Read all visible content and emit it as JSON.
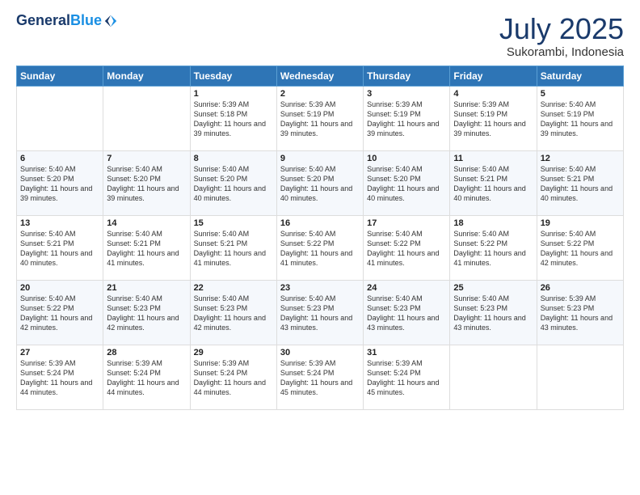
{
  "logo": {
    "line1": "General",
    "line2": "Blue"
  },
  "title": "July 2025",
  "subtitle": "Sukorambi, Indonesia",
  "days_of_week": [
    "Sunday",
    "Monday",
    "Tuesday",
    "Wednesday",
    "Thursday",
    "Friday",
    "Saturday"
  ],
  "weeks": [
    [
      {
        "day": "",
        "info": ""
      },
      {
        "day": "",
        "info": ""
      },
      {
        "day": "1",
        "info": "Sunrise: 5:39 AM\nSunset: 5:18 PM\nDaylight: 11 hours and 39 minutes."
      },
      {
        "day": "2",
        "info": "Sunrise: 5:39 AM\nSunset: 5:19 PM\nDaylight: 11 hours and 39 minutes."
      },
      {
        "day": "3",
        "info": "Sunrise: 5:39 AM\nSunset: 5:19 PM\nDaylight: 11 hours and 39 minutes."
      },
      {
        "day": "4",
        "info": "Sunrise: 5:39 AM\nSunset: 5:19 PM\nDaylight: 11 hours and 39 minutes."
      },
      {
        "day": "5",
        "info": "Sunrise: 5:40 AM\nSunset: 5:19 PM\nDaylight: 11 hours and 39 minutes."
      }
    ],
    [
      {
        "day": "6",
        "info": "Sunrise: 5:40 AM\nSunset: 5:20 PM\nDaylight: 11 hours and 39 minutes."
      },
      {
        "day": "7",
        "info": "Sunrise: 5:40 AM\nSunset: 5:20 PM\nDaylight: 11 hours and 39 minutes."
      },
      {
        "day": "8",
        "info": "Sunrise: 5:40 AM\nSunset: 5:20 PM\nDaylight: 11 hours and 40 minutes."
      },
      {
        "day": "9",
        "info": "Sunrise: 5:40 AM\nSunset: 5:20 PM\nDaylight: 11 hours and 40 minutes."
      },
      {
        "day": "10",
        "info": "Sunrise: 5:40 AM\nSunset: 5:20 PM\nDaylight: 11 hours and 40 minutes."
      },
      {
        "day": "11",
        "info": "Sunrise: 5:40 AM\nSunset: 5:21 PM\nDaylight: 11 hours and 40 minutes."
      },
      {
        "day": "12",
        "info": "Sunrise: 5:40 AM\nSunset: 5:21 PM\nDaylight: 11 hours and 40 minutes."
      }
    ],
    [
      {
        "day": "13",
        "info": "Sunrise: 5:40 AM\nSunset: 5:21 PM\nDaylight: 11 hours and 40 minutes."
      },
      {
        "day": "14",
        "info": "Sunrise: 5:40 AM\nSunset: 5:21 PM\nDaylight: 11 hours and 41 minutes."
      },
      {
        "day": "15",
        "info": "Sunrise: 5:40 AM\nSunset: 5:21 PM\nDaylight: 11 hours and 41 minutes."
      },
      {
        "day": "16",
        "info": "Sunrise: 5:40 AM\nSunset: 5:22 PM\nDaylight: 11 hours and 41 minutes."
      },
      {
        "day": "17",
        "info": "Sunrise: 5:40 AM\nSunset: 5:22 PM\nDaylight: 11 hours and 41 minutes."
      },
      {
        "day": "18",
        "info": "Sunrise: 5:40 AM\nSunset: 5:22 PM\nDaylight: 11 hours and 41 minutes."
      },
      {
        "day": "19",
        "info": "Sunrise: 5:40 AM\nSunset: 5:22 PM\nDaylight: 11 hours and 42 minutes."
      }
    ],
    [
      {
        "day": "20",
        "info": "Sunrise: 5:40 AM\nSunset: 5:22 PM\nDaylight: 11 hours and 42 minutes."
      },
      {
        "day": "21",
        "info": "Sunrise: 5:40 AM\nSunset: 5:23 PM\nDaylight: 11 hours and 42 minutes."
      },
      {
        "day": "22",
        "info": "Sunrise: 5:40 AM\nSunset: 5:23 PM\nDaylight: 11 hours and 42 minutes."
      },
      {
        "day": "23",
        "info": "Sunrise: 5:40 AM\nSunset: 5:23 PM\nDaylight: 11 hours and 43 minutes."
      },
      {
        "day": "24",
        "info": "Sunrise: 5:40 AM\nSunset: 5:23 PM\nDaylight: 11 hours and 43 minutes."
      },
      {
        "day": "25",
        "info": "Sunrise: 5:40 AM\nSunset: 5:23 PM\nDaylight: 11 hours and 43 minutes."
      },
      {
        "day": "26",
        "info": "Sunrise: 5:39 AM\nSunset: 5:23 PM\nDaylight: 11 hours and 43 minutes."
      }
    ],
    [
      {
        "day": "27",
        "info": "Sunrise: 5:39 AM\nSunset: 5:24 PM\nDaylight: 11 hours and 44 minutes."
      },
      {
        "day": "28",
        "info": "Sunrise: 5:39 AM\nSunset: 5:24 PM\nDaylight: 11 hours and 44 minutes."
      },
      {
        "day": "29",
        "info": "Sunrise: 5:39 AM\nSunset: 5:24 PM\nDaylight: 11 hours and 44 minutes."
      },
      {
        "day": "30",
        "info": "Sunrise: 5:39 AM\nSunset: 5:24 PM\nDaylight: 11 hours and 45 minutes."
      },
      {
        "day": "31",
        "info": "Sunrise: 5:39 AM\nSunset: 5:24 PM\nDaylight: 11 hours and 45 minutes."
      },
      {
        "day": "",
        "info": ""
      },
      {
        "day": "",
        "info": ""
      }
    ]
  ]
}
